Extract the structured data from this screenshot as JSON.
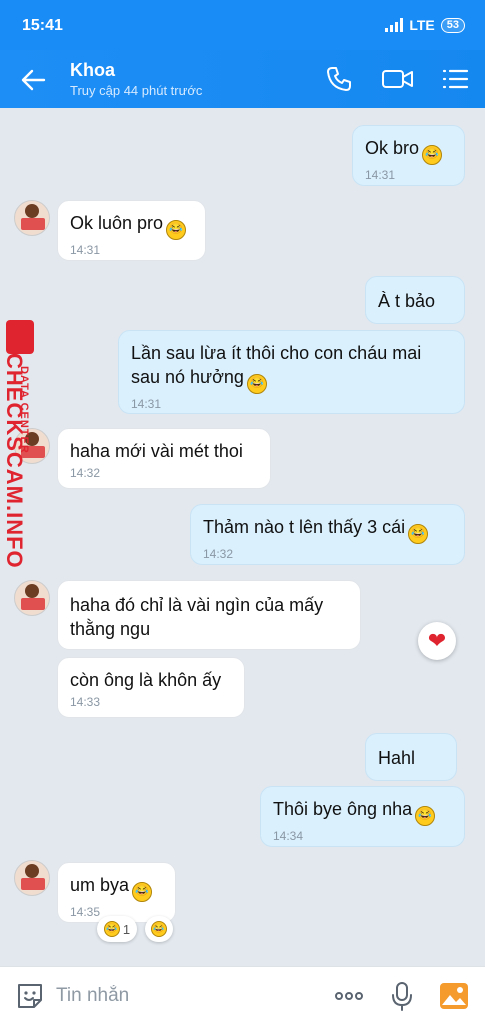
{
  "status_bar": {
    "time": "15:41",
    "network": "LTE",
    "battery": "53"
  },
  "header": {
    "name": "Khoa",
    "status": "Truy cập 44 phút trước",
    "icons": [
      "back-arrow-icon",
      "phone-icon",
      "video-call-icon",
      "menu-list-icon"
    ]
  },
  "messages": [
    {
      "dir": "out",
      "text": "Ok bro",
      "emoji": "laugh-cry",
      "time": "14:31"
    },
    {
      "dir": "in",
      "text": "Ok luôn pro",
      "emoji": "laugh-cry",
      "time": "14:31"
    },
    {
      "dir": "out",
      "text": "À t bảo",
      "time": ""
    },
    {
      "dir": "out",
      "text": "Lần sau lừa ít thôi cho con cháu mai sau nó hưởng",
      "emoji": "laugh-cry",
      "time": "14:31"
    },
    {
      "dir": "in",
      "text": "haha mới vài mét thoi",
      "time": "14:32"
    },
    {
      "dir": "out",
      "text": "Thảm nào t lên thấy 3 cái",
      "emoji": "laugh-cry",
      "time": "14:32"
    },
    {
      "dir": "in",
      "text": "haha đó chỉ là vài ngìn của mấy thằng ngu",
      "time": ""
    },
    {
      "dir": "in",
      "text": "còn ông là khôn ấy",
      "time": "14:33"
    },
    {
      "dir": "out",
      "text": "Hahl",
      "time": "",
      "reaction": "heart"
    },
    {
      "dir": "out",
      "text": "Thôi bye ông nha",
      "emoji": "laugh-cry",
      "time": "14:34"
    },
    {
      "dir": "in",
      "text": "um bya",
      "emoji": "laugh-cry",
      "time": "14:35",
      "reaction_count": "1"
    }
  ],
  "watermark": {
    "big": "CHECKSCAM.INFO",
    "small": "DATA CENTER"
  },
  "composer": {
    "placeholder": "Tin nhắn",
    "icons": [
      "sticker-icon",
      "more-options-icon",
      "microphone-icon",
      "image-gallery-icon"
    ]
  },
  "colors": {
    "header": "#1a8cf5",
    "outgoing": "#daf0fd",
    "incoming": "#ffffff",
    "background": "#e2e8ee",
    "watermark": "#e0242f"
  }
}
